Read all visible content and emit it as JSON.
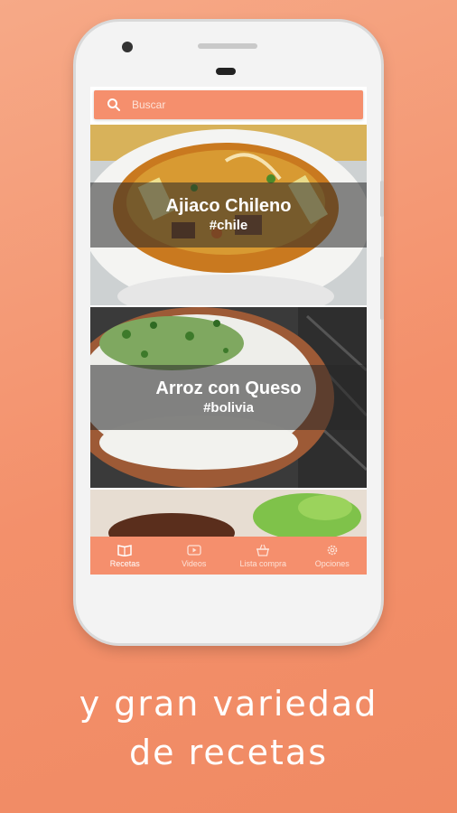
{
  "search": {
    "placeholder": "Buscar",
    "icon": "search-icon"
  },
  "recipes": [
    {
      "title": "Ajiaco Chileno",
      "tag": "#chile"
    },
    {
      "title": "Arroz con Queso",
      "tag": "#bolivia"
    }
  ],
  "nav": [
    {
      "label": "Recetas",
      "icon": "recipe-book-icon",
      "active": true
    },
    {
      "label": "Videos",
      "icon": "video-play-icon",
      "active": false
    },
    {
      "label": "Lista compra",
      "icon": "shopping-basket-icon",
      "active": false
    },
    {
      "label": "Opciones",
      "icon": "gear-icon",
      "active": false
    }
  ],
  "caption": {
    "line1": "y gran variedad",
    "line2": "de recetas"
  },
  "colors": {
    "accent": "#f58f6d",
    "background": "#f3906b"
  }
}
